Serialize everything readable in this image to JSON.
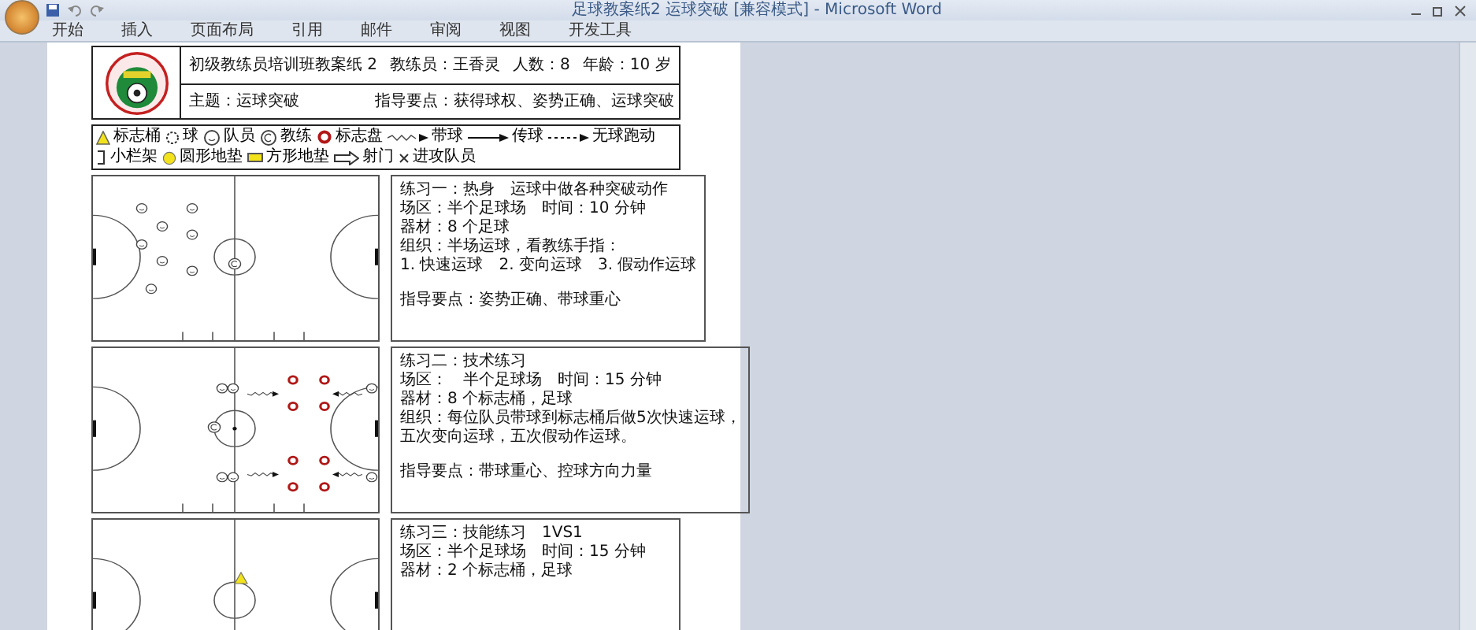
{
  "window": {
    "title": "足球教案纸2 运球突破 [兼容模式] - Microsoft Word"
  },
  "ribbon_tabs": [
    {
      "label": "开始",
      "selected": false
    },
    {
      "label": "插入",
      "selected": false
    },
    {
      "label": "页面布局",
      "selected": false
    },
    {
      "label": "引用",
      "selected": false
    },
    {
      "label": "邮件",
      "selected": false
    },
    {
      "label": "审阅",
      "selected": false
    },
    {
      "label": "视图",
      "selected": false
    },
    {
      "label": "开发工具",
      "selected": false
    }
  ],
  "header": {
    "row_1": [
      "初级教练员培训班教案纸 2",
      "教练员：王香灵",
      "人数：8",
      "年龄：10 岁"
    ],
    "row_2": [
      "主题：运球突破",
      "指导要点：获得球权、姿势正确、运球突破"
    ]
  },
  "legend": [
    [
      {
        "kind": "cone",
        "label": "标志桶"
      },
      {
        "kind": "ball",
        "label": "球"
      },
      {
        "kind": "player",
        "label": "队员"
      },
      {
        "kind": "coach",
        "label": "教练"
      },
      {
        "kind": "disc",
        "label": "标志盘"
      },
      {
        "kind": "dribble",
        "label": "带球"
      },
      {
        "kind": "pass",
        "label": "传球"
      },
      {
        "kind": "run",
        "label": "无球跑动"
      }
    ],
    [
      {
        "kind": "hurdle",
        "label": "小栏架"
      },
      {
        "kind": "round_mat",
        "label": "圆形地垫"
      },
      {
        "kind": "square_mat",
        "label": "方形地垫"
      },
      {
        "kind": "goal",
        "label": "射门"
      },
      {
        "kind": "attacker",
        "label": "进攻队员"
      }
    ]
  ],
  "exercises": [
    {
      "lines": [
        [
          "练习一：热身",
          "运球中做各种突破动作"
        ],
        [
          "场区：半个足球场",
          "时间：10 分钟"
        ],
        [
          "器材：8 个足球"
        ],
        [
          "组织：半场运球，看教练手指："
        ],
        [
          "1. 快速运球",
          "2. 变向运球",
          "3. 假动作运球"
        ],
        [
          "指导要点：姿势正确、带球重心"
        ]
      ]
    },
    {
      "lines": [
        [
          "练习二：技术练习"
        ],
        [
          "场区：",
          "半个足球场",
          "时间：15 分钟"
        ],
        [
          "器材：8 个标志桶，足球"
        ],
        [
          "组织：每位队员带球到标志桶后做5次快速运球，"
        ],
        [
          "五次变向运球，五次假动作运球。"
        ],
        [
          "指导要点：带球重心、控球方向力量"
        ]
      ]
    },
    {
      "lines": [
        [
          "练习三：技能练习",
          "1VS1"
        ],
        [
          "场区：半个足球场",
          "时间：15 分钟"
        ],
        [
          "器材：2 个标志桶，足球"
        ]
      ]
    }
  ]
}
